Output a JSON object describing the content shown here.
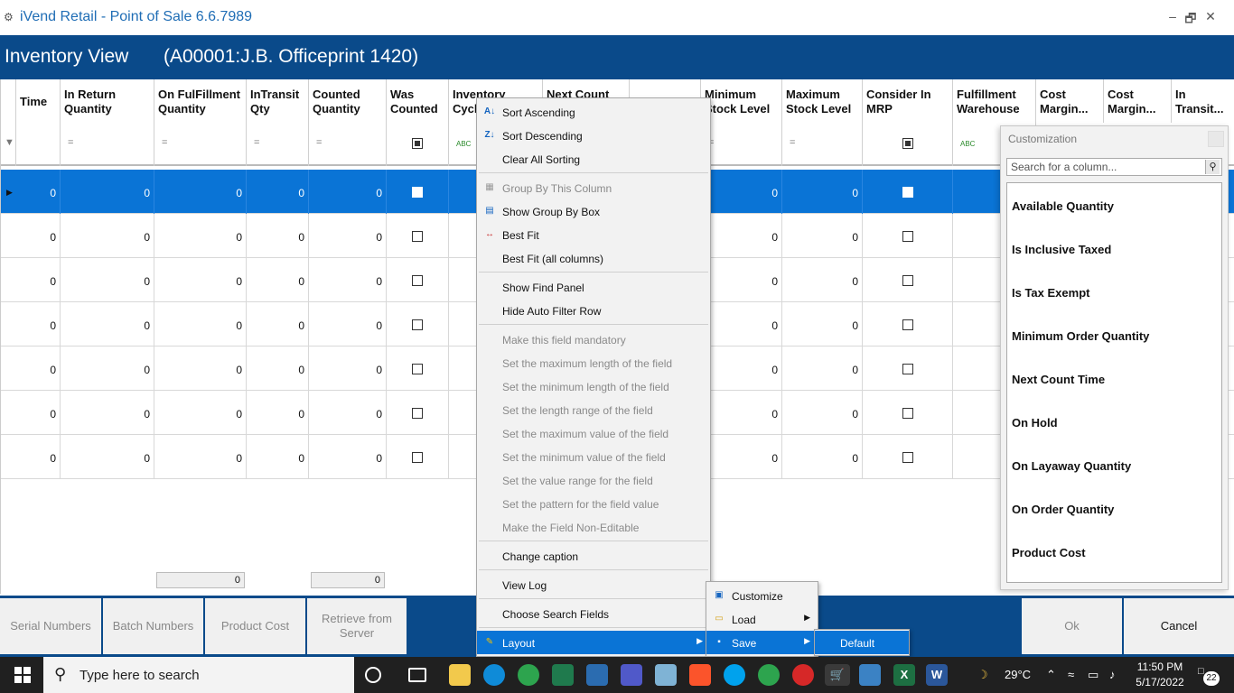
{
  "titlebar": {
    "title": "iVend Retail - Point of Sale 6.6.7989",
    "minimize": "–",
    "restore": "🗗",
    "close": "✕"
  },
  "header": {
    "view_title": "Inventory View",
    "item_title": "(A00001:J.B. Officeprint 1420)"
  },
  "grid": {
    "columns": [
      {
        "label": "Time"
      },
      {
        "label": "In Return Quantity"
      },
      {
        "label": "On FulFillment Quantity"
      },
      {
        "label": "InTransit Qty"
      },
      {
        "label": "Counted Quantity"
      },
      {
        "label": "Was Counted"
      },
      {
        "label": "Inventory Cycle"
      },
      {
        "label": "Next Count"
      },
      {
        "label": ""
      },
      {
        "label": "Minimum Stock Level"
      },
      {
        "label": "Maximum Stock Level"
      },
      {
        "label": "Consider In MRP"
      },
      {
        "label": "Fulfillment Warehouse"
      },
      {
        "label": "Cost Margin..."
      },
      {
        "label": "Cost Margin..."
      },
      {
        "label": "In Transit..."
      }
    ],
    "filter_equals": "=",
    "filter_abc": "ABC",
    "row_value": "0",
    "rows": [
      "0",
      "0",
      "0",
      "0",
      "0",
      "0",
      "0"
    ],
    "summary_fulfillment": "0",
    "summary_counted": "0"
  },
  "bottom": {
    "serial_numbers": "Serial Numbers",
    "batch_numbers": "Batch Numbers",
    "product_cost": "Product Cost",
    "retrieve_from_server": "Retrieve from Server",
    "ok": "Ok",
    "cancel": "Cancel"
  },
  "context_menu": {
    "sort_ascending": "Sort Ascending",
    "sort_descending": "Sort Descending",
    "clear_all_sorting": "Clear All Sorting",
    "group_by_column": "Group By This Column",
    "show_group_by_box": "Show Group By Box",
    "best_fit": "Best Fit",
    "best_fit_all": "Best Fit (all columns)",
    "show_find_panel": "Show Find Panel",
    "hide_auto_filter_row": "Hide Auto Filter Row",
    "make_mandatory": "Make this field mandatory",
    "set_max_length": "Set the maximum length of the field",
    "set_min_length": "Set the minimum length of the field",
    "set_length_range": "Set the length range of the field",
    "set_max_value": "Set the maximum value of the field",
    "set_min_value": "Set the minimum value of the field",
    "set_value_range": "Set the value range for the field",
    "set_pattern": "Set the pattern for the field value",
    "make_non_editable": "Make the Field Non-Editable",
    "change_caption": "Change caption",
    "view_log": "View Log",
    "choose_search_fields": "Choose Search Fields",
    "layout": "Layout"
  },
  "layout_submenu": {
    "customize": "Customize",
    "load": "Load",
    "save": "Save"
  },
  "save_submenu": {
    "default": "Default"
  },
  "customization": {
    "title": "Customization",
    "search_placeholder": "Search for a column...",
    "items": [
      "Available Quantity",
      "Is Inclusive Taxed",
      "Is Tax Exempt",
      "Minimum Order Quantity",
      "Next Count Time",
      "On Hold",
      "On Layaway Quantity",
      "On Order Quantity",
      "Product Cost"
    ]
  },
  "taskbar": {
    "search_placeholder": "Type here to search",
    "temperature": "29°C",
    "time": "11:50 PM",
    "date": "5/17/2022",
    "notifications": "22"
  },
  "colors": {
    "header_blue": "#0a4a8a",
    "selection_blue": "#0a74d6",
    "title_blue": "#1f6db5"
  }
}
